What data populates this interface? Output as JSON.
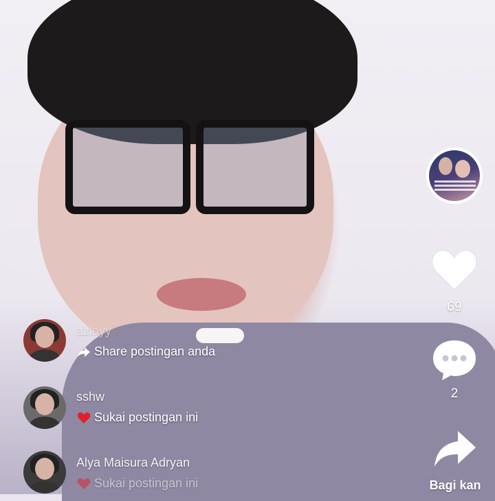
{
  "comments": [
    {
      "username": "azlayy",
      "action_text": "Share postingan anda",
      "action_icon": "share-arrow-icon"
    },
    {
      "username": "sshw",
      "action_text": "Sukai postingan ini",
      "action_icon": "heart-icon"
    },
    {
      "username": "Alya Maisura Adryan",
      "action_text": "Sukai postingan ini",
      "action_icon": "heart-icon"
    }
  ],
  "rail": {
    "like_count": "69",
    "comment_count": "2",
    "share_label": "Bagi kan"
  },
  "colors": {
    "heart_red": "#e0202a",
    "rail_white": "#ffffff"
  }
}
